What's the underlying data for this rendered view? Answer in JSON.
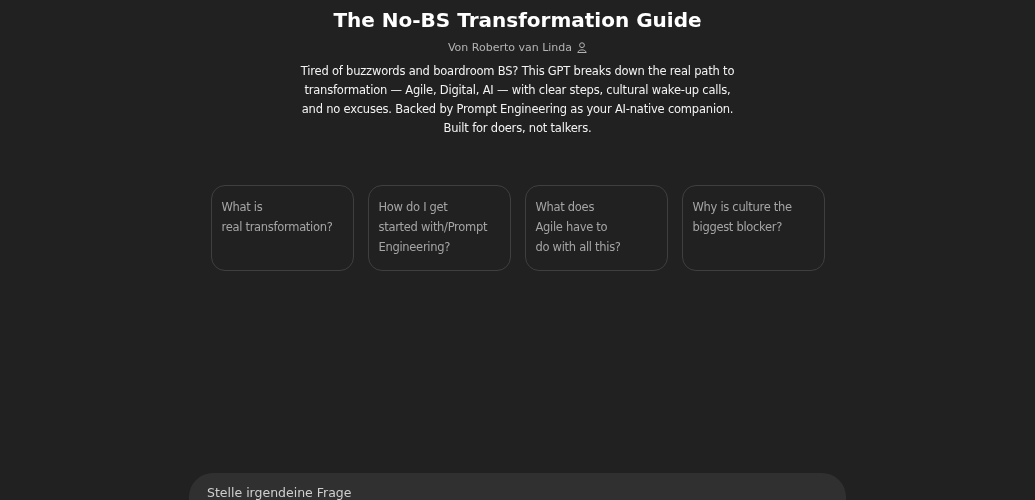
{
  "title": "The No-BS Transformation Guide",
  "author": "Von Roberto van Linda",
  "description": "Tired of buzzwords and boardroom BS? This GPT breaks down the real path to transformation — Agile, Digital, AI — with clear steps, cultural wake-up calls, and no excuses. Backed by Prompt Engineering as your AI-native companion. Built for doers, not talkers.",
  "suggestions": [
    "What is\nreal transformation?",
    "How do I get\nstarted with/Prompt\nEngineering?",
    "What does\nAgile have to\ndo with all this?",
    "Why is culture the\nbiggest blocker?"
  ],
  "composer": {
    "placeholder": "Stelle irgendeine Frage"
  }
}
